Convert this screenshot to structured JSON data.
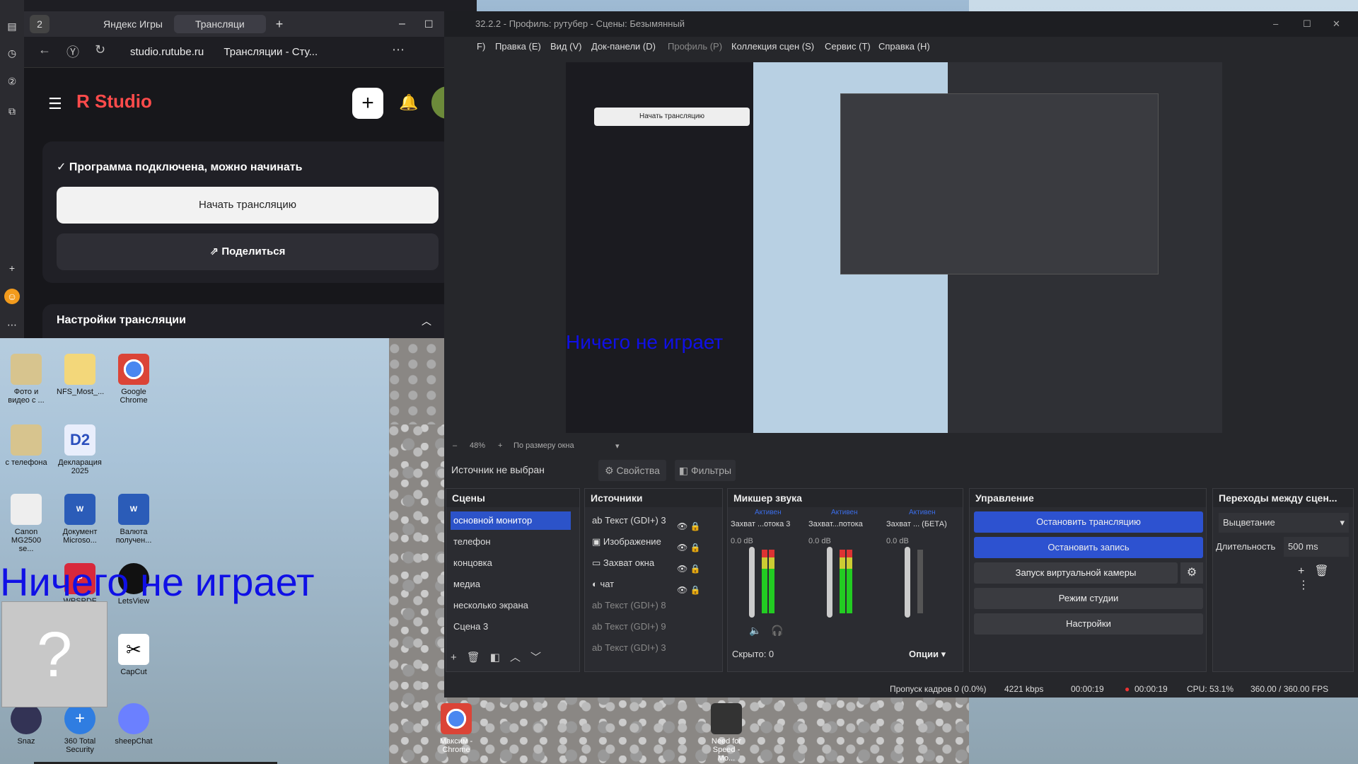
{
  "browser": {
    "tab_count": "2",
    "tab1": "Яндекс Игры",
    "tab2": "Трансляци",
    "url": "studio.rutube.ru",
    "page_title": "Трансляции - Сту...",
    "logo_r": "R",
    "logo_text": "Studio",
    "connected": "Программа подключена, можно начинать",
    "start_btn": "Начать трансляцию",
    "share_btn": "Поделиться",
    "settings": "Настройки трансляции"
  },
  "desktop": {
    "icons": [
      "Фото и видео с ...",
      "NFS_Most_...",
      "Google Chrome",
      "с телефона",
      "Декларация 2025",
      "Canon MG2500 se...",
      "Документ Microso...",
      "Валюта получен...",
      "WPSPDF",
      "LetsView",
      "CapCut",
      "Snaz",
      "360 Total Security",
      "sheepChat",
      "Максим - Chrome",
      "Need for Speed - Mo..."
    ],
    "now_playing": "Ничего не играет",
    "question": "?"
  },
  "obs": {
    "title": "32.2.2 - Профиль: рутубер - Сцены: Безымянный",
    "menu": [
      "Правка (E)",
      "Вид (V)",
      "Док-панели (D)",
      "Профиль (P)",
      "Коллекция сцен (S)",
      "Сервис (T)",
      "Справка (H)"
    ],
    "menu_partial": "F)",
    "zoom": "48%",
    "fit": "По размеру окна",
    "no_source": "Источник не выбран",
    "props": "Свойства",
    "filters": "Фильтры",
    "scenes_h": "Сцены",
    "scenes": [
      "основной монитор",
      "телефон",
      "концовка",
      "медиа",
      "несколько экрана",
      "Сцена 3"
    ],
    "sources_h": "Источники",
    "sources": [
      "Текст (GDI+) 3",
      "Изображение",
      "Захват окна",
      "чат",
      "Текст (GDI+) 8",
      "Текст (GDI+) 9",
      "Текст (GDI+) 3"
    ],
    "mixer_h": "Микшер звука",
    "channels": [
      {
        "state": "Активен",
        "name": "Захват ...отока 3",
        "db": "0.0 dB"
      },
      {
        "state": "Активен",
        "name": "Захват...потока",
        "db": "0.0 dB"
      },
      {
        "state": "Активен",
        "name": "Захват ... (БЕТА)",
        "db": "0.0 dB"
      }
    ],
    "scale": [
      "0",
      "-6",
      "-12",
      "-18",
      "-24",
      "-30",
      "-36",
      "-42",
      "-48",
      "-54",
      "-60"
    ],
    "hidden": "Скрыто: 0",
    "options": "Опции",
    "control_h": "Управление",
    "stop_stream": "Остановить трансляцию",
    "stop_rec": "Остановить запись",
    "virtual_cam": "Запуск виртуальной камеры",
    "studio_mode": "Режим студии",
    "settings": "Настройки",
    "trans_h": "Переходы между сцен...",
    "trans_value": "Выцветание",
    "duration_label": "Длительность",
    "duration_value": "500 ms",
    "status": {
      "dropped": "Пропуск кадров 0 (0.0%)",
      "kbps": "4221 kbps",
      "stream_time": "00:00:19",
      "rec_time": "00:00:19",
      "cpu": "CPU: 53.1%",
      "fps": "360.00 / 360.00 FPS"
    }
  },
  "colors": {
    "accent": "#2d52d0",
    "rutube_red": "#ff4b4b",
    "now_playing": "#1010e6"
  }
}
